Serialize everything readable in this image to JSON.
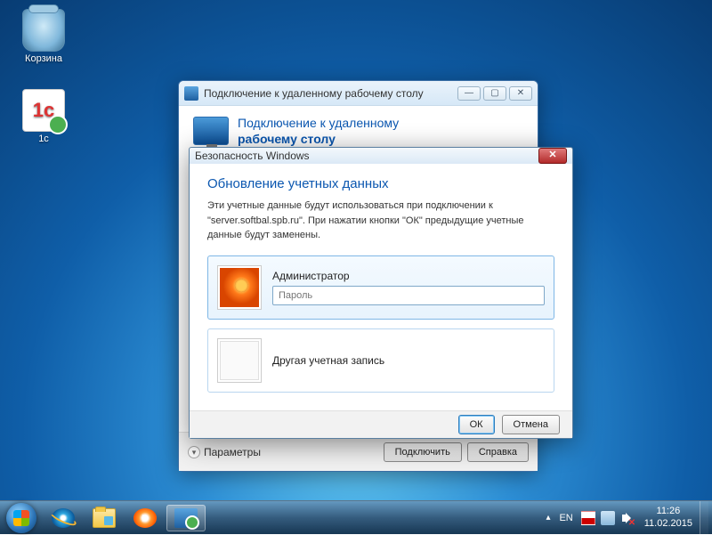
{
  "desktop": {
    "icons": [
      {
        "name": "recycle-bin",
        "label": "Корзина"
      },
      {
        "name": "onec-shortcut",
        "label": "1c"
      }
    ]
  },
  "rdc": {
    "title": "Подключение к удаленному рабочему столу",
    "banner_line1": "Подключение к удаленному",
    "banner_line2": "рабочему столу",
    "options_link": "Параметры",
    "connect_button": "Подключить",
    "help_button": "Справка"
  },
  "security": {
    "title": "Безопасность Windows",
    "heading": "Обновление учетных данных",
    "body_text": "Эти учетные данные будут использоваться при подключении к \"server.softbal.spb.ru\". При нажатии кнопки \"ОК\" предыдущие учетные данные будут заменены.",
    "accounts": {
      "selected": {
        "name": "Администратор",
        "password_placeholder": "Пароль",
        "password_value": ""
      },
      "other_label": "Другая учетная запись"
    },
    "ok_button": "ОК",
    "cancel_button": "Отмена"
  },
  "taskbar": {
    "language": "EN",
    "time": "11:26",
    "date": "11.02.2015"
  }
}
